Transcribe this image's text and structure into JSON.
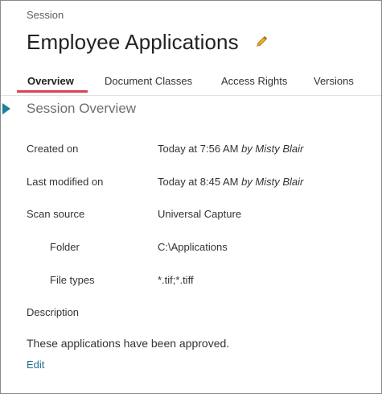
{
  "header": {
    "eyebrow": "Session",
    "title": "Employee Applications"
  },
  "tabs": [
    {
      "label": "Overview",
      "active": true
    },
    {
      "label": "Document Classes",
      "active": false
    },
    {
      "label": "Access Rights",
      "active": false
    },
    {
      "label": "Versions",
      "active": false
    }
  ],
  "overview": {
    "section_title": "Session Overview",
    "created_on": {
      "label": "Created on",
      "time": "Today at 7:56 AM",
      "by": "by Misty Blair"
    },
    "last_modified_on": {
      "label": "Last modified on",
      "time": "Today at 8:45 AM",
      "by": "by Misty Blair"
    },
    "scan_source": {
      "label": "Scan source",
      "value": "Universal Capture"
    },
    "folder": {
      "label": "Folder",
      "value": "C:\\Applications"
    },
    "file_types": {
      "label": "File types",
      "value": "*.tif;*.tiff"
    },
    "description": {
      "label": "Description",
      "value": "These applications have been approved."
    },
    "edit_label": "Edit"
  },
  "colors": {
    "accent_tab_underline": "#d9435a",
    "section_marker": "#1a7fa0",
    "link": "#1f6f8f",
    "pencil": "#e3a21a"
  },
  "icons": {
    "title_edit": "pencil-icon",
    "section_marker": "triangle-right-icon"
  }
}
